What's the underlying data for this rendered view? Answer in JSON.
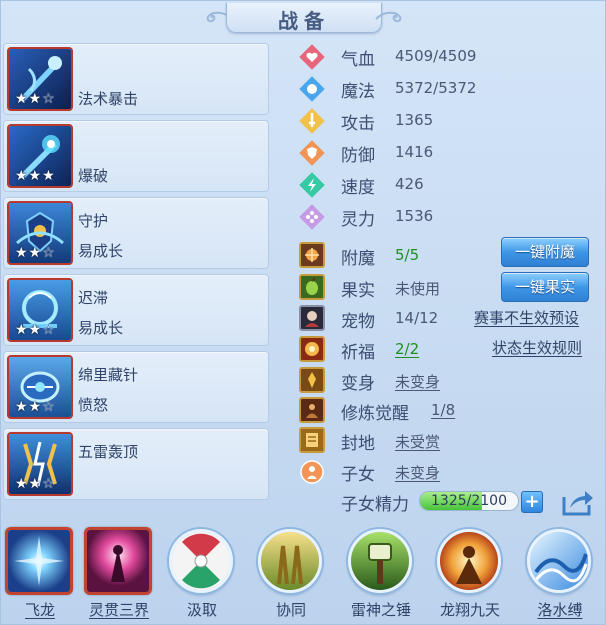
{
  "window": {
    "title": "战备"
  },
  "skills": [
    {
      "line1": "法术暴击",
      "line2": "",
      "stars": 2,
      "max_stars": 3
    },
    {
      "line1": "爆破",
      "line2": "",
      "stars": 3,
      "max_stars": 3
    },
    {
      "line1": "守护",
      "line2": "易成长",
      "stars": 2,
      "max_stars": 3
    },
    {
      "line1": "迟滞",
      "line2": "易成长",
      "stars": 2,
      "max_stars": 3
    },
    {
      "line1": "绵里藏针",
      "line2": "愤怒",
      "stars": 2,
      "max_stars": 3
    },
    {
      "line1": "五雷轰顶",
      "line2": "",
      "stars": 2,
      "max_stars": 3
    }
  ],
  "stats": [
    {
      "label": "气血",
      "value": "4509/4509",
      "icon": "heart-icon",
      "color": "#e7667b"
    },
    {
      "label": "魔法",
      "value": "5372/5372",
      "icon": "magic-icon",
      "color": "#4aa6ec"
    },
    {
      "label": "攻击",
      "value": "1365",
      "icon": "sword-icon",
      "color": "#f2c14a"
    },
    {
      "label": "防御",
      "value": "1416",
      "icon": "shield-icon",
      "color": "#f19456"
    },
    {
      "label": "速度",
      "value": "426",
      "icon": "speed-icon",
      "color": "#35c9a4"
    },
    {
      "label": "灵力",
      "value": "1536",
      "icon": "spirit-icon",
      "color": "#c59be6"
    }
  ],
  "extras": {
    "enchant": {
      "label": "附魔",
      "value": "5/5",
      "button": "一键附魔"
    },
    "fruit": {
      "label": "果实",
      "value": "未使用",
      "button": "一键果实"
    },
    "pet": {
      "label": "宠物",
      "value": "14/12",
      "link": "赛事不生效预设"
    },
    "bless": {
      "label": "祈福",
      "value": "2/2",
      "link": "状态生效规则"
    },
    "transform": {
      "label": "变身",
      "value": "未变身"
    },
    "cultivate": {
      "label": "修炼觉醒",
      "value": "1/8"
    },
    "fief": {
      "label": "封地",
      "value": "未受赏"
    },
    "children": {
      "label": "子女",
      "value": "未变身"
    },
    "child_energy": {
      "label": "子女精力",
      "value": "1325/2100",
      "current": 1325,
      "max": 2100,
      "plus": "+"
    }
  },
  "bottom_skills": [
    {
      "name": "飞龙",
      "framed": true,
      "underlined": true
    },
    {
      "name": "灵贯三界",
      "framed": true,
      "underlined": true
    },
    {
      "name": "汲取",
      "framed": false,
      "underlined": false
    },
    {
      "name": "协同",
      "framed": false,
      "underlined": false
    },
    {
      "name": "雷神之锤",
      "framed": false,
      "underlined": false
    },
    {
      "name": "龙翔九天",
      "framed": false,
      "underlined": false
    },
    {
      "name": "洛水缚",
      "framed": false,
      "underlined": true
    }
  ]
}
